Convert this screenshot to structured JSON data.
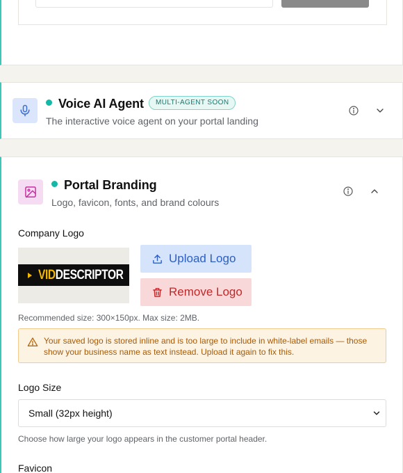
{
  "voice_section": {
    "title": "Voice AI Agent",
    "badge": "MULTI-AGENT SOON",
    "subtitle": "The interactive voice agent on your portal landing",
    "icon": "microphone-icon"
  },
  "branding_section": {
    "title": "Portal Branding",
    "subtitle": "Logo, favicon, fonts, and brand colours",
    "icon": "image-icon",
    "company_logo": {
      "label": "Company Logo",
      "logo_text_accent": "VID",
      "logo_text_main": "DESCRIPTOR",
      "upload_label": "Upload Logo",
      "remove_label": "Remove Logo",
      "hint": "Recommended size: 300×150px. Max size: 2MB."
    },
    "warning": "Your saved logo is stored inline and is too large to include in white-label emails — those show your business name as text instead. Upload it again to fix this.",
    "logo_size": {
      "label": "Logo Size",
      "selected": "Small (32px height)",
      "hint": "Choose how large your logo appears in the customer portal header."
    },
    "favicon": {
      "label": "Favicon"
    }
  },
  "colors": {
    "accent_teal": "#14b8a6",
    "upload_bg": "#d6e4fb",
    "remove_bg": "#f8d8d8",
    "warning_bg": "#fcf3e3"
  }
}
